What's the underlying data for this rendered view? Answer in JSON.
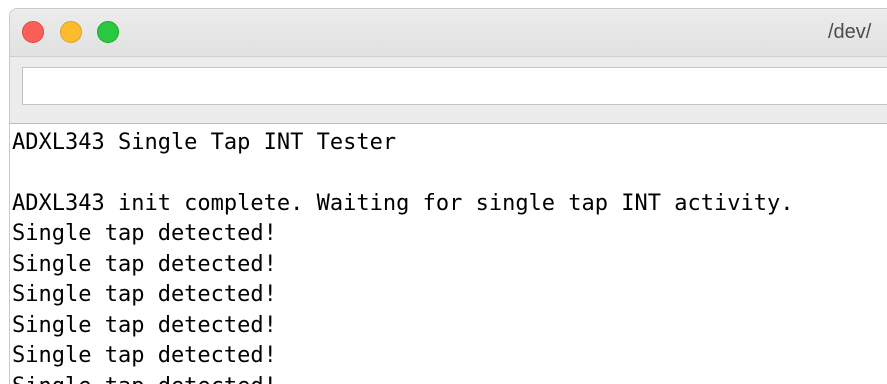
{
  "window": {
    "title": "/dev/"
  },
  "toolbar": {
    "send_input_value": ""
  },
  "output": {
    "lines": [
      "ADXL343 Single Tap INT Tester",
      "",
      "ADXL343 init complete. Waiting for single tap INT activity.",
      "Single tap detected!",
      "Single tap detected!",
      "Single tap detected!",
      "Single tap detected!",
      "Single tap detected!",
      "Single tap detected!"
    ]
  }
}
